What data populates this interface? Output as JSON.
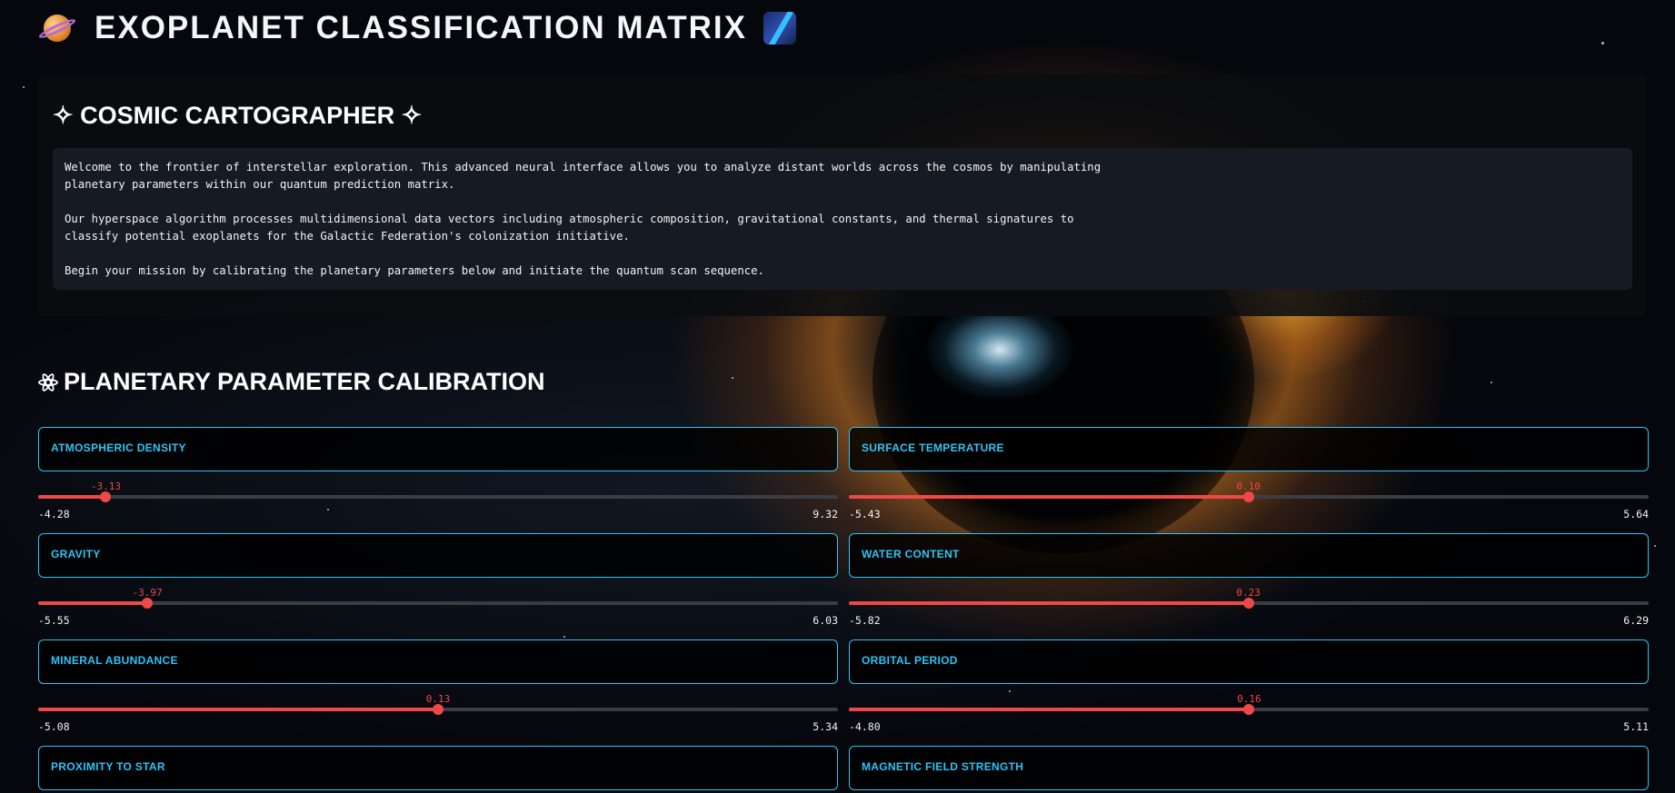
{
  "app_title": "EXOPLANET CLASSIFICATION MATRIX",
  "icons": {
    "title_left": "ringed-planet-icon",
    "title_right": "milky-way-icon",
    "section": "atom-icon"
  },
  "colors": {
    "accent": "#2ec4f5",
    "slider": "#ee4848",
    "panel": "#161b23"
  },
  "intro": {
    "title": "✧ COSMIC CARTOGRAPHER ✧",
    "paragraphs": [
      "Welcome to the frontier of interstellar exploration. This advanced neural interface allows you to analyze distant worlds across the cosmos by manipulating\nplanetary parameters within our quantum prediction matrix.",
      "Our hyperspace algorithm processes multidimensional data vectors including atmospheric composition, gravitational constants, and thermal signatures to\nclassify potential exoplanets for the Galactic Federation's colonization initiative.",
      "Begin your mission by calibrating the planetary parameters below and initiate the quantum scan sequence."
    ]
  },
  "calibration": {
    "title": "PLANETARY PARAMETER CALIBRATION",
    "params": [
      {
        "label": "ATMOSPHERIC DENSITY",
        "min": "-4.28",
        "max": "9.32",
        "value": "-3.13",
        "min_num": -4.28,
        "max_num": 9.32,
        "value_num": -3.13
      },
      {
        "label": "SURFACE TEMPERATURE",
        "min": "-5.43",
        "max": "5.64",
        "value": "0.10",
        "min_num": -5.43,
        "max_num": 5.64,
        "value_num": 0.1
      },
      {
        "label": "GRAVITY",
        "min": "-5.55",
        "max": "6.03",
        "value": "-3.97",
        "min_num": -5.55,
        "max_num": 6.03,
        "value_num": -3.97
      },
      {
        "label": "WATER CONTENT",
        "min": "-5.82",
        "max": "6.29",
        "value": "0.23",
        "min_num": -5.82,
        "max_num": 6.29,
        "value_num": 0.23
      },
      {
        "label": "MINERAL ABUNDANCE",
        "min": "-5.08",
        "max": "5.34",
        "value": "0.13",
        "min_num": -5.08,
        "max_num": 5.34,
        "value_num": 0.13
      },
      {
        "label": "ORBITAL PERIOD",
        "min": "-4.80",
        "max": "5.11",
        "value": "0.16",
        "min_num": -4.8,
        "max_num": 5.11,
        "value_num": 0.16
      },
      {
        "label": "PROXIMITY TO STAR"
      },
      {
        "label": "MAGNETIC FIELD STRENGTH"
      }
    ]
  }
}
